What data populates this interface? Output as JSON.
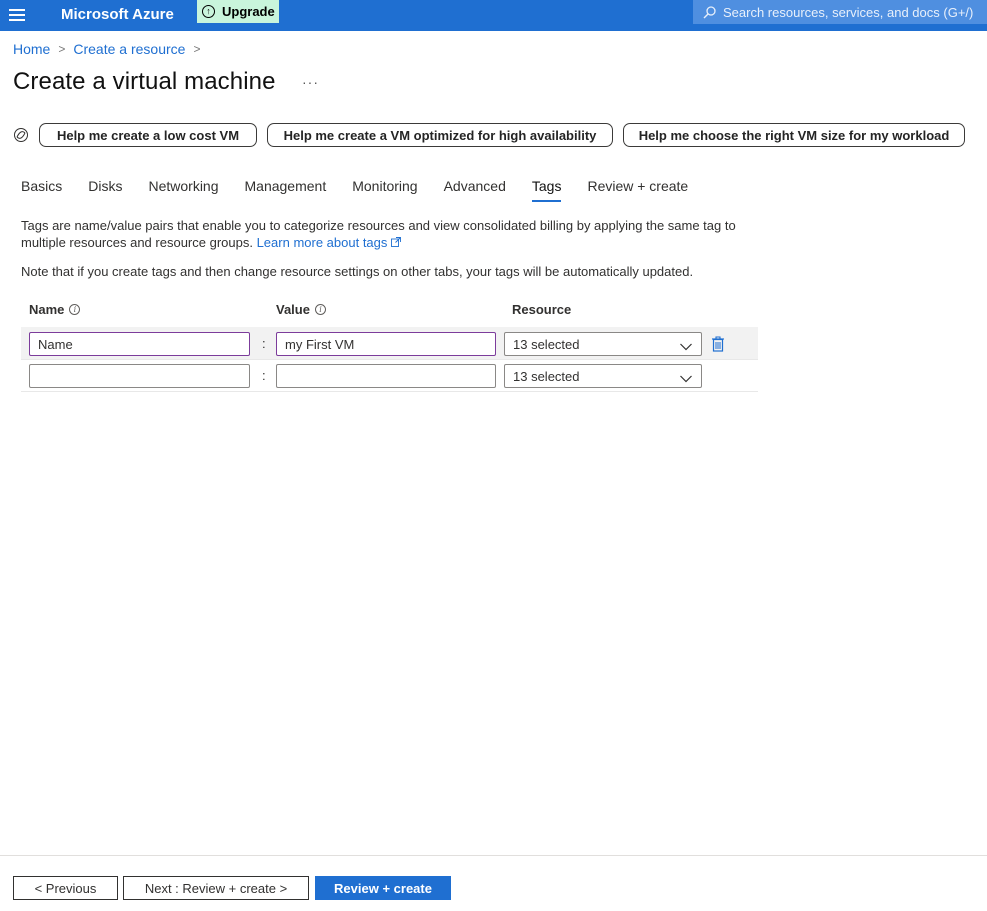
{
  "topbar": {
    "brand": "Microsoft Azure",
    "upgrade_label": "Upgrade",
    "search_placeholder": "Search resources, services, and docs (G+/)",
    "color": "#1f6fd1"
  },
  "breadcrumb": {
    "items": [
      "Home",
      "Create a resource"
    ]
  },
  "page": {
    "title": "Create a virtual machine",
    "more": "···"
  },
  "help_buttons": [
    "Help me create a low cost VM",
    "Help me create a VM optimized for high availability",
    "Help me choose the right VM size for my workload"
  ],
  "tabs": [
    {
      "label": "Basics",
      "active": false
    },
    {
      "label": "Disks",
      "active": false
    },
    {
      "label": "Networking",
      "active": false
    },
    {
      "label": "Management",
      "active": false
    },
    {
      "label": "Monitoring",
      "active": false
    },
    {
      "label": "Advanced",
      "active": false
    },
    {
      "label": "Tags",
      "active": true
    },
    {
      "label": "Review + create",
      "active": false
    }
  ],
  "content": {
    "description": "Tags are name/value pairs that enable you to categorize resources and view consolidated billing by applying the same tag to multiple resources and resource groups.",
    "learn_more": "Learn more about tags",
    "note": "Note that if you create tags and then change resource settings on other tabs, your tags will be automatically updated."
  },
  "table": {
    "headers": {
      "name": "Name",
      "value": "Value",
      "resource": "Resource"
    },
    "separator": ":",
    "rows": [
      {
        "name": "Name",
        "value": "my First VM",
        "resource": "13 selected"
      },
      {
        "name": "",
        "value": "",
        "resource": "13 selected"
      }
    ]
  },
  "footer": {
    "previous": "< Previous",
    "next": "Next : Review + create >",
    "review": "Review + create"
  }
}
